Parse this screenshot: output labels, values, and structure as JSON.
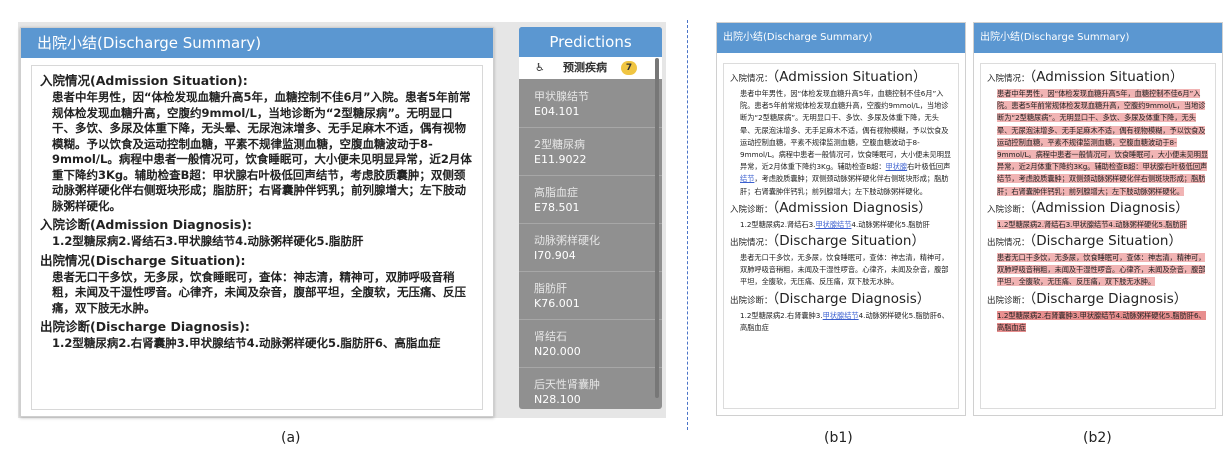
{
  "panel_a": {
    "title": "出院小结(Discharge Summary)",
    "sections": [
      {
        "heading": "入院情况(Admission Situation):",
        "body": "患者中年男性，因“体检发现血糖升高5年，血糖控制不佳6月”入院。患者5年前常规体检发现血糖升高，空腹约9mmol/L，当地诊断为“2型糖尿病”。无明显口干、多饮、多尿及体重下降，无头晕、无尿泡沫增多、无手足麻木不适，偶有视物模糊。予以饮食及运动控制血糖，平素不规律监测血糖，空腹血糖波动于8-9mmol/L。病程中患者一般情况可，饮食睡眠可，大小便未见明显异常，近2月体重下降约3Kg。辅助检查B超：甲状腺右叶极低回声结节，考虑胶质囊肿；双侧颈动脉粥样硬化伴右侧斑块形成；脂肪肝；右肾囊肿伴钙乳；前列腺增大；左下肢动脉粥样硬化。"
      },
      {
        "heading": "入院诊断(Admission Diagnosis):",
        "body": "1.2型糖尿病2.肾结石3.甲状腺结节4.动脉粥样硬化5.脂肪肝"
      },
      {
        "heading": "出院情况(Discharge Situation):",
        "body": "患者无口干多饮，无多尿，饮食睡眠可，查体：神志清，精神可，双肺呼吸音稍粗，未闻及干湿性啰音。心律齐，未闻及杂音，腹部平坦，全腹软，无压痛、反压痛，双下肢无水肿。"
      },
      {
        "heading": "出院诊断(Discharge Diagnosis):",
        "body": "1.2型糖尿病2.右肾囊肿3.甲状腺结节4.动脉粥样硬化5.脂肪肝6、高脂血症"
      }
    ]
  },
  "predictions": {
    "title": "Predictions",
    "selected": {
      "icon": "wheelchair-icon",
      "label": "预测疾病",
      "count": "7"
    },
    "items": [
      {
        "name": "甲状腺结节",
        "code": "E04.101"
      },
      {
        "name": "2型糖尿病",
        "code": "E11.9022"
      },
      {
        "name": "高脂血症",
        "code": "E78.501"
      },
      {
        "name": "动脉粥样硬化",
        "code": "I70.904"
      },
      {
        "name": "脂肪肝",
        "code": "K76.001"
      },
      {
        "name": "肾结石",
        "code": "N20.000"
      },
      {
        "name": "后天性肾囊肿",
        "code": "N28.100"
      }
    ]
  },
  "panel_b": {
    "title": "出院小结(Discharge Summary)",
    "admission_label": "入院情况：",
    "admission_en": "（Admission Situation）",
    "admission_body_1": "患者中年男性，因“体检发现血糖升高5年，血糖控制不佳6月”入院。患者5年前常规体检发现血糖升高，空腹约9mmol/L，当地诊断为“2型糖尿病”。无明显口干、多饮、多尿及体重下降，无头晕、无尿泡沫增多、无手足麻木不适，偶有视物模糊，予以饮食及运动控制血糖，平素不规律监测血糖，空腹血糖波动于8-9mmol/L。病程中患者一般情况可，饮食睡眠可，大小便未见明显异常，近2月体重下降约3Kg。辅助检查B超：",
    "admission_link_1": "甲状腺",
    "admission_body_2": "右叶极低回声",
    "admission_link_2": "结节",
    "admission_body_3": "，考虑胶质囊肿；双侧颈动脉粥样硬化伴右侧斑块形成；脂肪肝；右肾囊肿伴钙乳；前列腺增大；左下肢动脉粥样硬化。",
    "adm_diag_label": "入院诊断：",
    "adm_diag_en": "（Admission Diagnosis）",
    "adm_diag_1": "1.2型糖尿病2.肾结石3.",
    "adm_diag_link": "甲状腺结节",
    "adm_diag_2": "4.动脉粥样硬化5.脂肪肝",
    "dis_sit_label": "出院情况：",
    "dis_sit_en": "（Discharge Situation）",
    "dis_sit_body": "患者无口干多饮，无多尿，饮食睡眠可，查体：神志清，精神可，双肺呼吸音稍粗，未闻及干湿性啰音。心律齐，未闻及杂音，腹部平坦，全腹软，无压痛、反压痛，双下肢无水肿。",
    "dis_diag_label": "出院诊断：",
    "dis_diag_en": "（Discharge Diagnosis）",
    "dis_diag_1": "1.2型糖尿病2.右肾囊肿3.",
    "dis_diag_link": "甲状腺结节",
    "dis_diag_2": "4.动脉粥样硬化5.脂肪肝6、高脂血症"
  },
  "panel_b2": {
    "admission_body": "患者中年男性，因“体检发现血糖升高5年，血糖控制不佳6月”入院。患者5年前常规体检发现血糖升高，空腹约9mmol/L，当地诊断为“2型糖尿病”。无明显口干、多饮、多尿及体重下降，无头晕、无尿泡沫增多、无手足麻木不适，偶有视物模糊，予以饮食及运动控制血糖，平素不规律监测血糖，空腹血糖波动于8-9mmol/L。病程中患者一般情况可，饮食睡眠可，大小便未见明显异常，近2月体重下降约3Kg。辅助检查B超：甲状腺右叶极低回声结节，考虑胶质囊肿；双侧颈动脉粥样硬化伴右侧斑块形成；脂肪肝；右肾囊肿伴钙乳；前列腺增大；左下肢动脉粥样硬化。",
    "adm_diag": "1.2型糖尿病2.肾结石3.甲状腺结节4.动脉粥样硬化5.脂肪肝",
    "dis_diag": "1.2型糖尿病2.右肾囊肿3.甲状腺结节4.动脉粥样硬化5.脂肪肝6、高脂血症"
  },
  "captions": {
    "a": "(a)",
    "b1": "(b1)",
    "b2": "(b2)"
  },
  "colors": {
    "header_blue": "#5b97d1",
    "highlight": "#f1b4b4",
    "link": "#3a5fcf",
    "divider": "#4a74c8"
  }
}
